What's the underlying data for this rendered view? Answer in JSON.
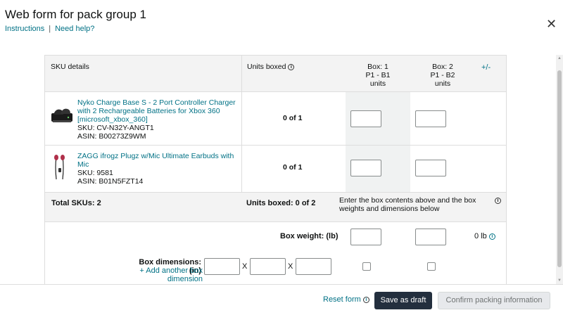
{
  "header": {
    "title": "Web form for pack group 1",
    "instructions_link": "Instructions",
    "separator": "|",
    "help_link": "Need help?",
    "close_glyph": "✕"
  },
  "table": {
    "col_sku": "SKU details",
    "col_units": "Units boxed",
    "boxes": [
      {
        "line1": "Box: 1",
        "line2": "P1 - B1",
        "line3": "units"
      },
      {
        "line1": "Box: 2",
        "line2": "P1 - B2",
        "line3": "units"
      }
    ],
    "plus_minus": "+/-",
    "products": [
      {
        "title": "Nyko Charge Base S - 2 Port Controller Charger with 2 Rechargeable Batteries for Xbox 360 [microsoft_xbox_360]",
        "title_lines": [
          "Nyko Charge Base S - 2 Port Controller Charger",
          "with 2 Rechargeable Batteries for Xbox 360",
          "[microsoft_xbox_360]"
        ],
        "sku": "SKU: CV-N32Y-ANGT1",
        "asin": "ASIN: B00273Z9WM",
        "units_boxed": "0 of 1",
        "image_icon": "controller-charger-icon"
      },
      {
        "title": "ZAGG ifrogz Plugz w/Mic Ultimate Earbuds with Mic",
        "title_lines": [
          "ZAGG ifrogz Plugz w/Mic Ultimate Earbuds with",
          "Mic"
        ],
        "sku": "SKU: 9581",
        "asin": "ASIN: B01N5FZT14",
        "units_boxed": "0 of 1",
        "image_icon": "earbuds-icon"
      }
    ],
    "total_skus": "Total SKUs: 2",
    "total_units_boxed": "Units boxed: 0 of 2",
    "total_hint_line1": "Enter the box contents above and the box",
    "total_hint_line2": "weights and dimensions below",
    "box_weight_label": "Box weight: (lb)",
    "weight_total": "0 lb",
    "box_dimensions_label": "Box dimensions: (in)",
    "add_dimension_link": "+ Add another box dimension",
    "dim_separator": "X"
  },
  "footer": {
    "reset_label": "Reset form",
    "draft_label": "Save as draft",
    "confirm_label": "Confirm packing information"
  }
}
